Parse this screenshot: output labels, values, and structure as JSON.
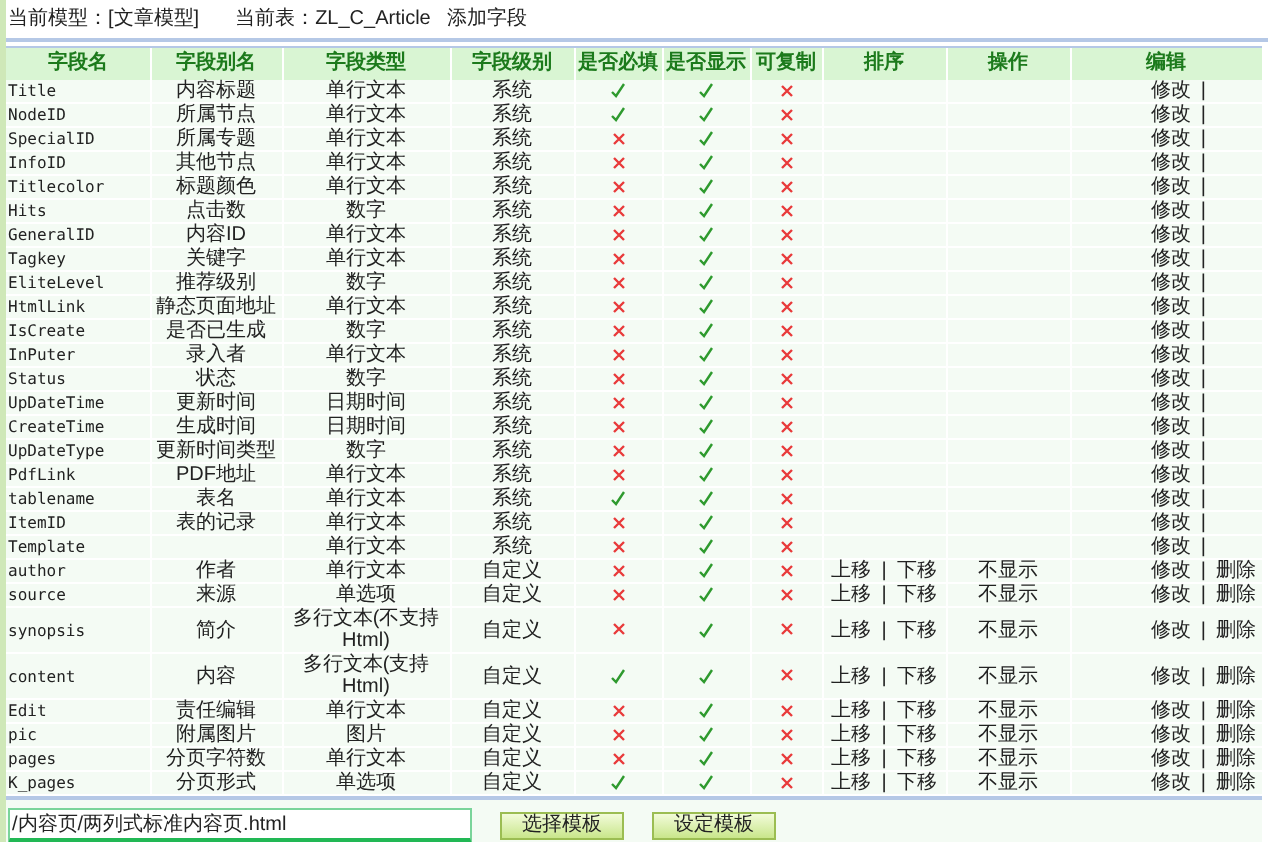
{
  "topbar": {
    "model_label": "当前模型：[文章模型]",
    "table_label": "当前表：ZL_C_Article",
    "add_link": "添加字段"
  },
  "table": {
    "columns": [
      "字段名",
      "字段别名",
      "字段类型",
      "字段级别",
      "是否必填",
      "是否显示",
      "可复制",
      "排序",
      "操作",
      "编辑"
    ],
    "rows": [
      {
        "name": "Title",
        "alias": "内容标题",
        "type": "单行文本",
        "level": "系统",
        "required": true,
        "shown": true,
        "copyable": false,
        "edit": "修改",
        "edit_sep": "|"
      },
      {
        "name": "NodeID",
        "alias": "所属节点",
        "type": "单行文本",
        "level": "系统",
        "required": true,
        "shown": true,
        "copyable": false,
        "edit": "修改",
        "edit_sep": "|"
      },
      {
        "name": "SpecialID",
        "alias": "所属专题",
        "type": "单行文本",
        "level": "系统",
        "required": false,
        "shown": true,
        "copyable": false,
        "edit": "修改",
        "edit_sep": "|"
      },
      {
        "name": "InfoID",
        "alias": "其他节点",
        "type": "单行文本",
        "level": "系统",
        "required": false,
        "shown": true,
        "copyable": false,
        "edit": "修改",
        "edit_sep": "|"
      },
      {
        "name": "Titlecolor",
        "alias": "标题颜色",
        "type": "单行文本",
        "level": "系统",
        "required": false,
        "shown": true,
        "copyable": false,
        "edit": "修改",
        "edit_sep": "|"
      },
      {
        "name": "Hits",
        "alias": "点击数",
        "type": "数字",
        "level": "系统",
        "required": false,
        "shown": true,
        "copyable": false,
        "edit": "修改",
        "edit_sep": "|"
      },
      {
        "name": "GeneralID",
        "alias": "内容ID",
        "type": "单行文本",
        "level": "系统",
        "required": false,
        "shown": true,
        "copyable": false,
        "edit": "修改",
        "edit_sep": "|"
      },
      {
        "name": "Tagkey",
        "alias": "关键字",
        "type": "单行文本",
        "level": "系统",
        "required": false,
        "shown": true,
        "copyable": false,
        "edit": "修改",
        "edit_sep": "|"
      },
      {
        "name": "EliteLevel",
        "alias": "推荐级别",
        "type": "数字",
        "level": "系统",
        "required": false,
        "shown": true,
        "copyable": false,
        "edit": "修改",
        "edit_sep": "|"
      },
      {
        "name": "HtmlLink",
        "alias": "静态页面地址",
        "type": "单行文本",
        "level": "系统",
        "required": false,
        "shown": true,
        "copyable": false,
        "edit": "修改",
        "edit_sep": "|"
      },
      {
        "name": "IsCreate",
        "alias": "是否已生成",
        "type": "数字",
        "level": "系统",
        "required": false,
        "shown": true,
        "copyable": false,
        "edit": "修改",
        "edit_sep": "|"
      },
      {
        "name": "InPuter",
        "alias": "录入者",
        "type": "单行文本",
        "level": "系统",
        "required": false,
        "shown": true,
        "copyable": false,
        "edit": "修改",
        "edit_sep": "|"
      },
      {
        "name": "Status",
        "alias": "状态",
        "type": "数字",
        "level": "系统",
        "required": false,
        "shown": true,
        "copyable": false,
        "edit": "修改",
        "edit_sep": "|"
      },
      {
        "name": "UpDateTime",
        "alias": "更新时间",
        "type": "日期时间",
        "level": "系统",
        "required": false,
        "shown": true,
        "copyable": false,
        "edit": "修改",
        "edit_sep": "|"
      },
      {
        "name": "CreateTime",
        "alias": "生成时间",
        "type": "日期时间",
        "level": "系统",
        "required": false,
        "shown": true,
        "copyable": false,
        "edit": "修改",
        "edit_sep": "|"
      },
      {
        "name": "UpDateType",
        "alias": "更新时间类型",
        "type": "数字",
        "level": "系统",
        "required": false,
        "shown": true,
        "copyable": false,
        "edit": "修改",
        "edit_sep": "|"
      },
      {
        "name": "PdfLink",
        "alias": "PDF地址",
        "type": "单行文本",
        "level": "系统",
        "required": false,
        "shown": true,
        "copyable": false,
        "edit": "修改",
        "edit_sep": "|"
      },
      {
        "name": "tablename",
        "alias": "表名",
        "type": "单行文本",
        "level": "系统",
        "required": true,
        "shown": true,
        "copyable": false,
        "edit": "修改",
        "edit_sep": "|"
      },
      {
        "name": "ItemID",
        "alias": "表的记录",
        "type": "单行文本",
        "level": "系统",
        "required": false,
        "shown": true,
        "copyable": false,
        "edit": "修改",
        "edit_sep": "|"
      },
      {
        "name": "Template",
        "type": "单行文本",
        "level": "系统",
        "required": false,
        "shown": true,
        "copyable": false,
        "edit": "修改",
        "edit_sep": "|"
      },
      {
        "name": "author",
        "alias": "作者",
        "type": "单行文本",
        "level": "自定义",
        "required": false,
        "shown": true,
        "copyable": false,
        "sort_up": "上移",
        "sort_sep": "|",
        "sort_down": "下移",
        "operation": "不显示",
        "edit": "修改",
        "edit_sep": "|",
        "delete": "删除"
      },
      {
        "name": "source",
        "alias": "来源",
        "type": "单选项",
        "level": "自定义",
        "required": false,
        "shown": true,
        "copyable": false,
        "sort_up": "上移",
        "sort_sep": "|",
        "sort_down": "下移",
        "operation": "不显示",
        "edit": "修改",
        "edit_sep": "|",
        "delete": "删除"
      },
      {
        "name": "synopsis",
        "alias": "简介",
        "type": "多行文本(不支持Html)",
        "level": "自定义",
        "required": false,
        "shown": true,
        "copyable": false,
        "sort_up": "上移",
        "sort_sep": "|",
        "sort_down": "下移",
        "operation": "不显示",
        "edit": "修改",
        "edit_sep": "|",
        "delete": "删除"
      },
      {
        "name": "content",
        "alias": "内容",
        "type": "多行文本(支持Html)",
        "level": "自定义",
        "required": true,
        "shown": true,
        "copyable": false,
        "sort_up": "上移",
        "sort_sep": "|",
        "sort_down": "下移",
        "operation": "不显示",
        "edit": "修改",
        "edit_sep": "|",
        "delete": "删除"
      },
      {
        "name": "Edit",
        "alias": "责任编辑",
        "type": "单行文本",
        "level": "自定义",
        "required": false,
        "shown": true,
        "copyable": false,
        "sort_up": "上移",
        "sort_sep": "|",
        "sort_down": "下移",
        "operation": "不显示",
        "edit": "修改",
        "edit_sep": "|",
        "delete": "删除"
      },
      {
        "name": "pic",
        "alias": "附属图片",
        "type": "图片",
        "level": "自定义",
        "required": false,
        "shown": true,
        "copyable": false,
        "sort_up": "上移",
        "sort_sep": "|",
        "sort_down": "下移",
        "operation": "不显示",
        "edit": "修改",
        "edit_sep": "|",
        "delete": "删除"
      },
      {
        "name": "pages",
        "alias": "分页字符数",
        "type": "单行文本",
        "level": "自定义",
        "required": false,
        "shown": true,
        "copyable": false,
        "sort_up": "上移",
        "sort_sep": "|",
        "sort_down": "下移",
        "operation": "不显示",
        "edit": "修改",
        "edit_sep": "|",
        "delete": "删除"
      },
      {
        "name": "K_pages",
        "alias": "分页形式",
        "type": "单选项",
        "level": "自定义",
        "required": true,
        "shown": true,
        "copyable": false,
        "sort_up": "上移",
        "sort_sep": "|",
        "sort_down": "下移",
        "operation": "不显示",
        "edit": "修改",
        "edit_sep": "|",
        "delete": "删除"
      }
    ]
  },
  "footer": {
    "template_path": "/内容页/两列式标准内容页.html",
    "buttons": [
      "选择模板",
      "设定模板"
    ]
  }
}
